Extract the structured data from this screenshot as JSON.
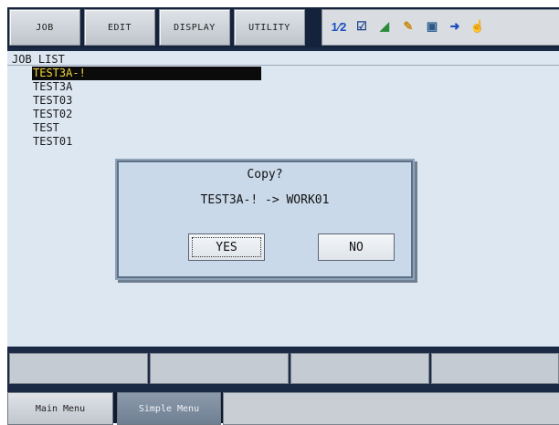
{
  "top_menu": {
    "items": [
      {
        "label": "JOB"
      },
      {
        "label": "EDIT"
      },
      {
        "label": "DISPLAY"
      },
      {
        "label": "UTILITY"
      }
    ],
    "status_icons": [
      {
        "name": "group-axes-icon",
        "glyph": "1⁄2",
        "color": "#1d4fbf"
      },
      {
        "name": "edit-mode-icon",
        "glyph": "☑",
        "color": "#1d3f8a"
      },
      {
        "name": "play-mode-icon",
        "glyph": "◢",
        "color": "#2a8a3a"
      },
      {
        "name": "teach-mode-icon",
        "glyph": "✎",
        "color": "#c98a12"
      },
      {
        "name": "servo-icon",
        "glyph": "▣",
        "color": "#2a5a8a"
      },
      {
        "name": "step-icon",
        "glyph": "➜",
        "color": "#1d4fbf"
      },
      {
        "name": "hand-icon",
        "glyph": "☝",
        "color": "#d8a200"
      }
    ]
  },
  "job_list": {
    "title": "JOB LIST",
    "items": [
      {
        "name": "TEST3A-!",
        "selected": true
      },
      {
        "name": "TEST3A",
        "selected": false
      },
      {
        "name": "TEST03",
        "selected": false
      },
      {
        "name": "TEST02",
        "selected": false
      },
      {
        "name": "TEST",
        "selected": false
      },
      {
        "name": "TEST01",
        "selected": false
      }
    ]
  },
  "dialog": {
    "title": "Copy?",
    "message": "TEST3A-! -> WORK01",
    "yes_label": "YES",
    "no_label": "NO"
  },
  "bottom_menu": {
    "main_menu_label": "Main Menu",
    "simple_menu_label": "Simple Menu"
  }
}
